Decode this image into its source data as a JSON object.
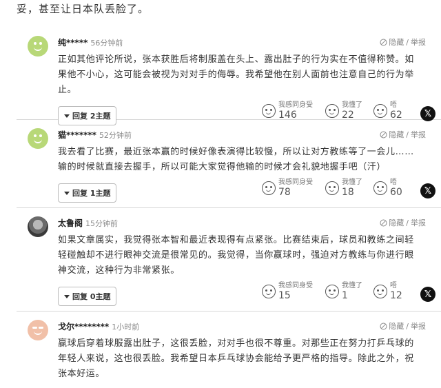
{
  "top_text": "妥，甚至让日本队丢脸了。",
  "labels": {
    "hide": "隐藏",
    "separator": "/",
    "report": "举报",
    "react_same": "我感同身受",
    "react_understand": "我懂了",
    "react_wow": "唔"
  },
  "comments": [
    {
      "username": "纯*****",
      "time": "56分钟前",
      "text": "正如其他评论所说，张本获胜后将制服盖在头上、露出肚子的行为实在不值得称赞。如果他不小心，这可能会被视为对对手的侮辱。我希望他在别人面前也注意自己的行为举止。",
      "reply_label": "回复 2主题",
      "same": "146",
      "understand": "22",
      "wow": "62",
      "avatar": "green-smile"
    },
    {
      "username": "猫*******",
      "time": "52分钟前",
      "text": "我去看了比赛，最近张本赢的时候好像表演得比较慢，所以让对方教练等了一会儿……输的时候就直接去握手，所以可能大家觉得他输的时候才会礼貌地握手吧（汗）",
      "reply_label": "回复 1主题",
      "same": "78",
      "understand": "18",
      "wow": "60",
      "avatar": "green-smile"
    },
    {
      "username": "太鲁阁",
      "time": "15分钟前",
      "text": "如果文章属实，我觉得张本智和最近表现得有点紧张。比赛结束后，球员和教练之间轻轻碰触却不进行眼神交流是很常见的。我觉得，当你赢球时，强迫对方教练与你进行眼神交流，这种行为非常紧张。",
      "reply_label": "回复 0主题",
      "same": "15",
      "understand": "1",
      "wow": "12",
      "avatar": "photo"
    },
    {
      "username": "戈尔********",
      "time": "1小时前",
      "text": "赢球后穿着球服露出肚子，这很丢脸，对对手也很不尊重。对那些正在努力打乒乓球的年轻人来说，这也很丢脸。我希望日本乒乓球协会能给予更严格的指导。除此之外，祝张本好运。",
      "reply_label": "",
      "same": "",
      "understand": "",
      "wow": "",
      "avatar": "peach"
    }
  ]
}
